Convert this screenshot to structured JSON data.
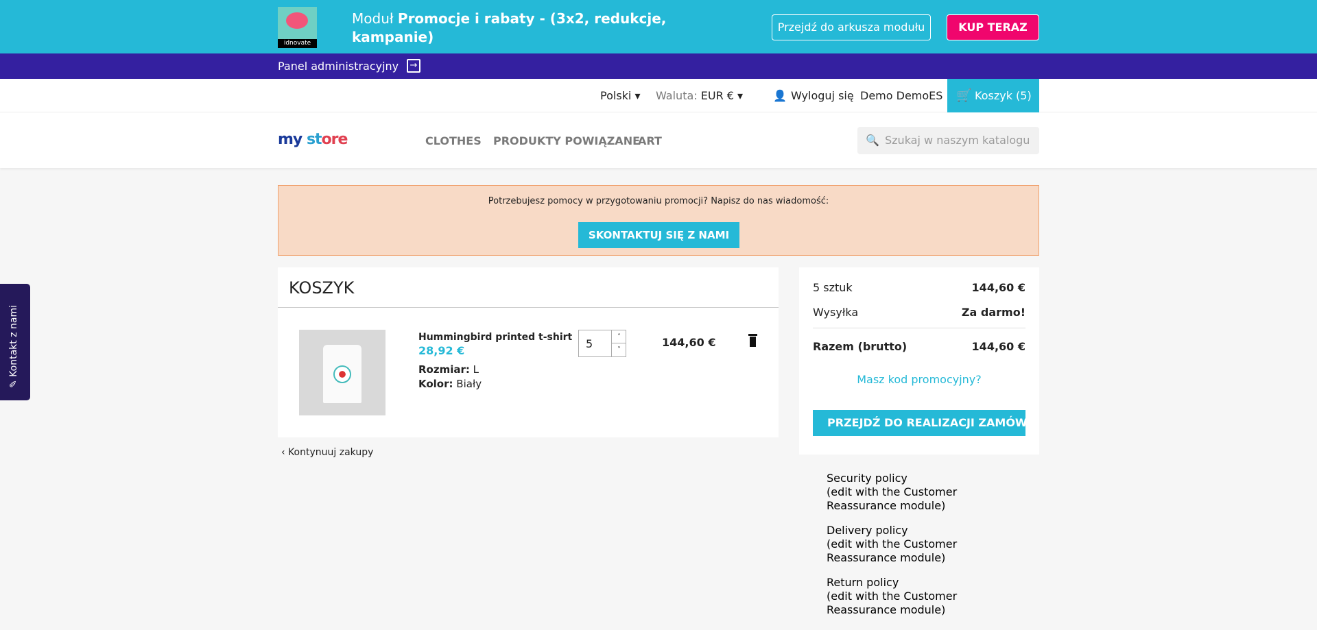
{
  "module_bar": {
    "logo_text": "idnovate",
    "title_prefix": "Moduł ",
    "title_bold": "Promocje i rabaty - (3x2, redukcje, kampanie)",
    "sheet_button": "Przejdź do arkusza modułu",
    "buy_button": "KUP TERAZ"
  },
  "admin_bar": {
    "label": "Panel administracyjny",
    "icon": "exit-icon"
  },
  "header": {
    "language": "Polski",
    "currency_label": "Waluta:",
    "currency": "EUR €",
    "logout": "Wyloguj się",
    "user": "Demo DemoES",
    "cart": "Koszyk (5)"
  },
  "nav": {
    "logo": "my store",
    "items": [
      "CLOTHES",
      "PRODUKTY POWIĄZANE",
      "ART"
    ],
    "search_placeholder": "Szukaj w naszym katalogu"
  },
  "promo_banner": {
    "text": "Potrzebujesz pomocy w przygotowaniu promocji? Napisz do nas wiadomość:",
    "button": "SKONTAKTUJ SIĘ Z NAMI"
  },
  "cart": {
    "title": "KOSZYK",
    "items": [
      {
        "name": "Hummingbird printed t-shirt",
        "price": "28,92 €",
        "size_label": "Rozmiar:",
        "size": "L",
        "color_label": "Kolor:",
        "color": "Biały",
        "quantity": "5",
        "total": "144,60 €"
      }
    ],
    "continue": "Kontynuuj zakupy"
  },
  "summary": {
    "items_label": "5 sztuk",
    "items_value": "144,60 €",
    "shipping_label": "Wysyłka",
    "shipping_value": "Za darmo!",
    "total_label": "Razem (brutto)",
    "total_value": "144,60 €",
    "promo_link": "Masz kod promocyjny?",
    "checkout": "PRZEJDŹ DO REALIZACJI ZAMÓWIENIA"
  },
  "reassurance": [
    {
      "title": "Security policy",
      "text": "(edit with the Customer Reassurance module)"
    },
    {
      "title": "Delivery policy",
      "text": "(edit with the Customer Reassurance module)"
    },
    {
      "title": "Return policy",
      "text": "(edit with the Customer Reassurance module)"
    }
  ],
  "side_tab": "Kontakt z nami"
}
